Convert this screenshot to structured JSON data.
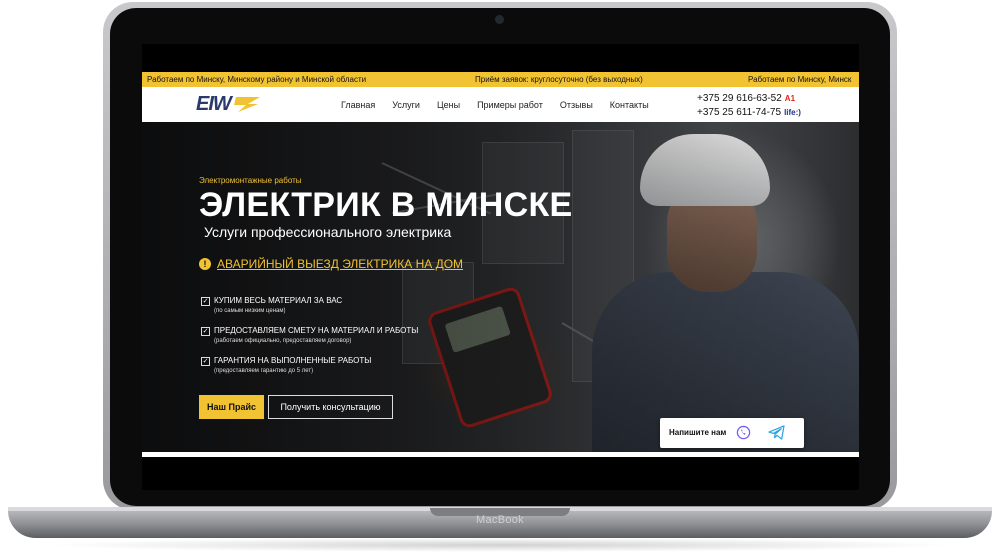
{
  "device": {
    "brand_label": "MacBook"
  },
  "ticker": {
    "items": [
      "Работаем по Минску, Минскому району и Минской области",
      "Приём заявок: круглосуточно (без выходных)",
      "Работаем по Минску, Минск"
    ]
  },
  "nav": {
    "logo_text": "EIW",
    "menu": [
      "Главная",
      "Услуги",
      "Цены",
      "Примеры работ",
      "Отзывы",
      "Контакты"
    ],
    "phones": [
      {
        "number": "+375 29 616-63-52",
        "operator": "A1"
      },
      {
        "number": "+375 25 611-74-75",
        "operator": "life:)"
      }
    ]
  },
  "hero": {
    "eyebrow": "Электромонтажные работы",
    "title": "ЭЛЕКТРИК В МИНСКЕ",
    "subtitle": "Услуги профессионального электрика",
    "emergency_link": "АВАРИЙНЫЙ ВЫЕЗД ЭЛЕКТРИКА НА ДОМ",
    "features": [
      {
        "title": "КУПИМ ВЕСЬ МАТЕРИАЛ ЗА ВАС",
        "note": "(по самым низким ценам)"
      },
      {
        "title": "ПРЕДОСТАВЛЯЕМ СМЕТУ НА МАТЕРИАЛ И РАБОТЫ",
        "note": "(работаем официально, предоставляем договор)"
      },
      {
        "title": "ГАРАНТИЯ НА ВЫПОЛНЕННЫЕ РАБОТЫ",
        "note": "(предоставляем гарантию до 5 лет)"
      }
    ],
    "buttons": {
      "price": "Наш Прайс",
      "consult": "Получить консультацию"
    }
  },
  "contact_widget": {
    "label": "Напишите нам"
  },
  "colors": {
    "accent": "#f1c232",
    "a1": "#e2231a",
    "life": "#1d2f8a",
    "viber": "#7360f2",
    "telegram": "#2aa3df"
  }
}
